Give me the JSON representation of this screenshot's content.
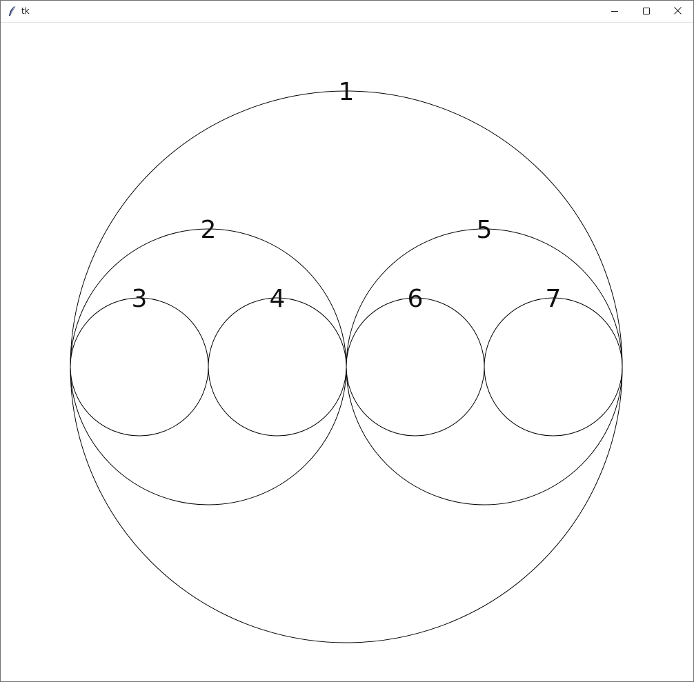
{
  "window": {
    "title": "tk",
    "icon": "tk-feather-icon",
    "buttons": {
      "minimize": "minimize-icon",
      "maximize": "maximize-icon",
      "close": "close-icon"
    }
  },
  "canvas": {
    "background": "#ffffff",
    "stroke_color": "#000000",
    "circles": [
      {
        "label": "1"
      },
      {
        "label": "2"
      },
      {
        "label": "3"
      },
      {
        "label": "4"
      },
      {
        "label": "5"
      },
      {
        "label": "6"
      },
      {
        "label": "7"
      }
    ]
  }
}
